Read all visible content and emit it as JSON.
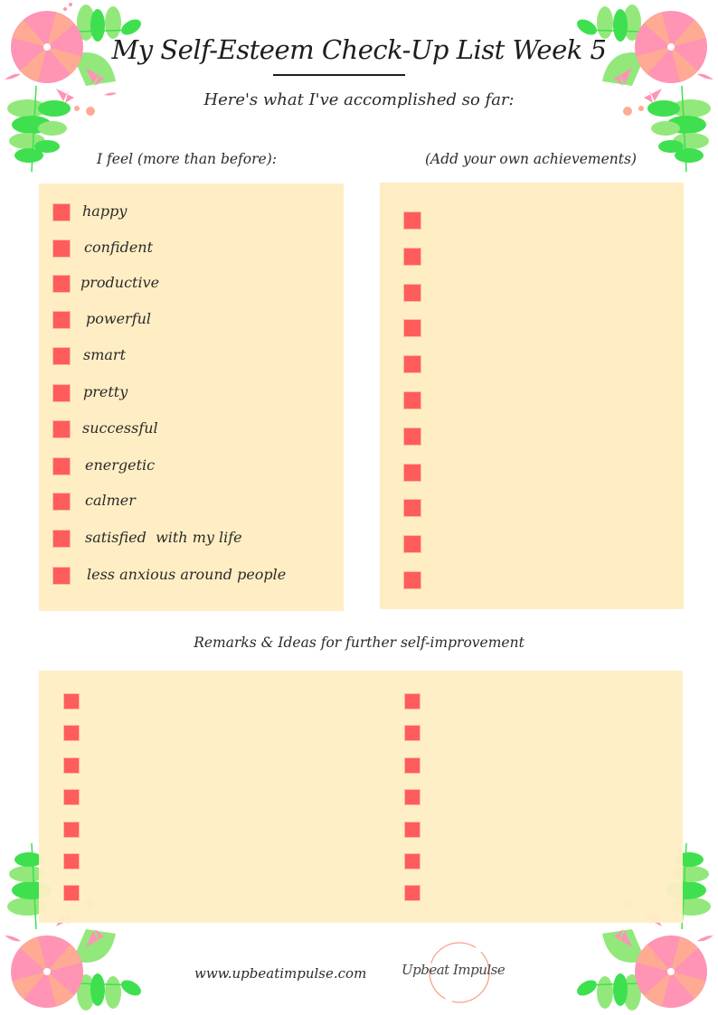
{
  "header": {
    "title": "My Self-Esteem Check-Up List Week 5",
    "subtitle": "Here's what I've accomplished so far:"
  },
  "feelings": {
    "heading": "I feel (more than before):",
    "items": [
      {
        "label": "happy",
        "checked": false
      },
      {
        "label": "confident",
        "checked": false
      },
      {
        "label": "productive",
        "checked": false
      },
      {
        "label": "powerful",
        "checked": false
      },
      {
        "label": "smart",
        "checked": false
      },
      {
        "label": "pretty",
        "checked": false
      },
      {
        "label": "successful",
        "checked": false
      },
      {
        "label": "energetic",
        "checked": false
      },
      {
        "label": "calmer",
        "checked": false
      },
      {
        "label": "satisfied  with my life",
        "checked": false
      },
      {
        "label": "less anxious around people",
        "checked": false
      }
    ]
  },
  "achievements": {
    "heading": "(Add your own achievements)",
    "blank_count": 11
  },
  "remarks": {
    "heading": "Remarks & Ideas for further self-improvement",
    "left_blank_count": 7,
    "right_blank_count": 7
  },
  "footer": {
    "url": "www.upbeatimpulse.com",
    "logo_text": "Upbeat Impulse"
  },
  "colors": {
    "panel": "#ffeec4",
    "checkbox": "#ff5c5c",
    "flower_pink": "#ff94b4",
    "flower_peach": "#ffab94",
    "leaf_green": "#3ee04f",
    "leaf_light": "#93e87c"
  }
}
